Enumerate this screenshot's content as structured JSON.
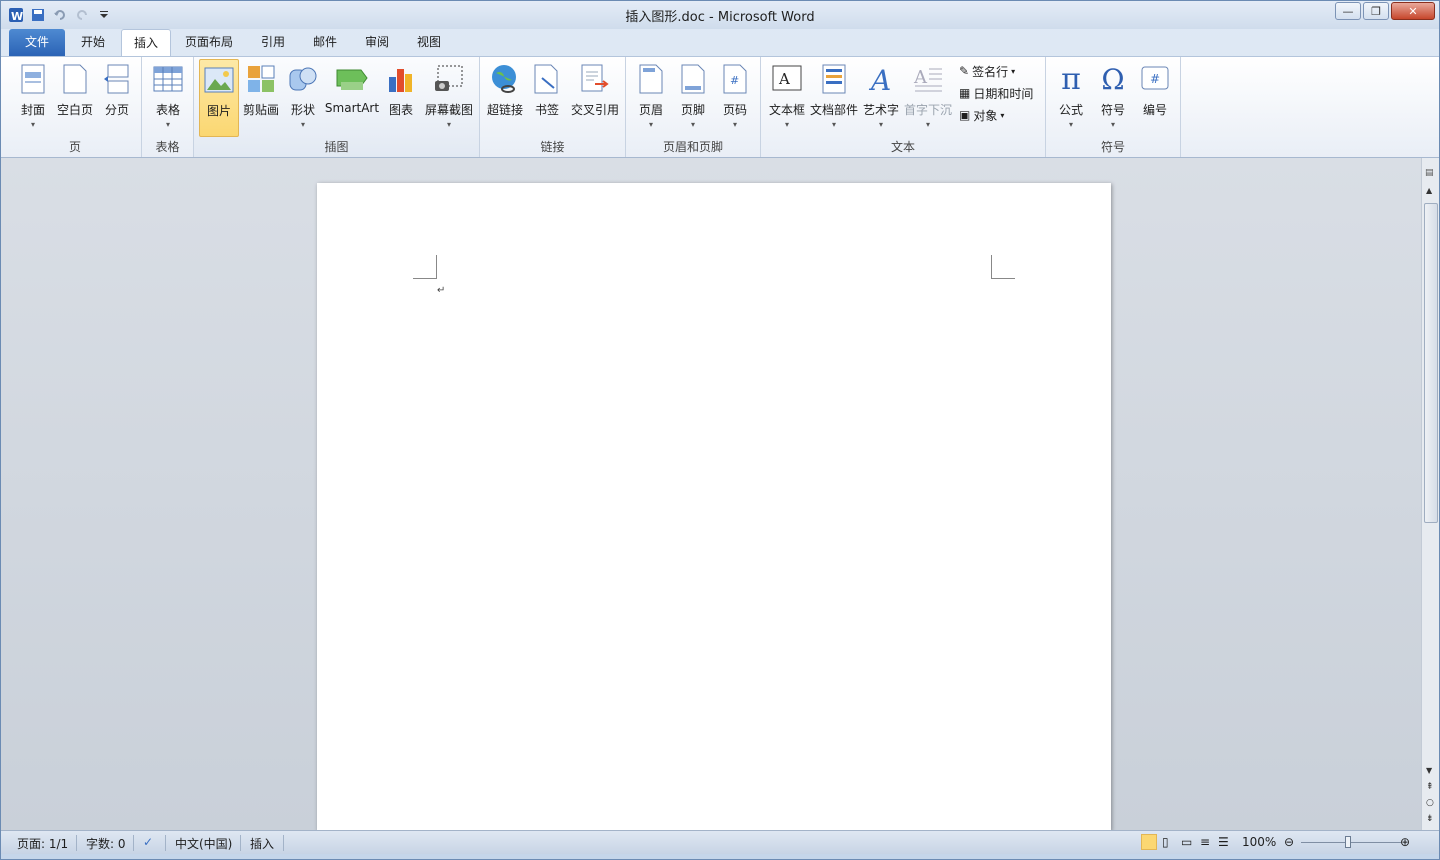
{
  "window": {
    "title": "插入图形.doc - Microsoft Word",
    "min": "—",
    "max": "❐",
    "close": "✕"
  },
  "tabs": [
    "文件",
    "开始",
    "插入",
    "页面布局",
    "引用",
    "邮件",
    "审阅",
    "视图"
  ],
  "help": {
    "collapse": "^",
    "help": "?"
  },
  "ribbon": {
    "groups": {
      "pages": "页",
      "tables": "表格",
      "illustrations": "插图",
      "links": "链接",
      "header_footer": "页眉和页脚",
      "text": "文本",
      "symbols": "符号"
    },
    "buttons": {
      "cover": "封面",
      "blank": "空白页",
      "break": "分页",
      "table": "表格",
      "picture": "图片",
      "clipart": "剪贴画",
      "shapes": "形状",
      "smartart": "SmartArt",
      "chart": "图表",
      "screenshot": "屏幕截图",
      "hyperlink": "超链接",
      "bookmark": "书签",
      "crossref": "交叉引用",
      "header": "页眉",
      "footer": "页脚",
      "pagenum": "页码",
      "textbox": "文本框",
      "quickparts": "文档部件",
      "wordart": "艺术字",
      "dropcap": "首字下沉",
      "signature": "签名行",
      "datetime": "日期和时间",
      "object": "对象",
      "equation": "公式",
      "symbol": "符号",
      "number": "编号"
    }
  },
  "status": {
    "page": "页面: 1/1",
    "words": "字数: 0",
    "lang": "中文(中国)",
    "mode": "插入",
    "zoom": "100%"
  },
  "colors": {
    "accent": "#2b63b5",
    "selected": "#fbd772"
  }
}
